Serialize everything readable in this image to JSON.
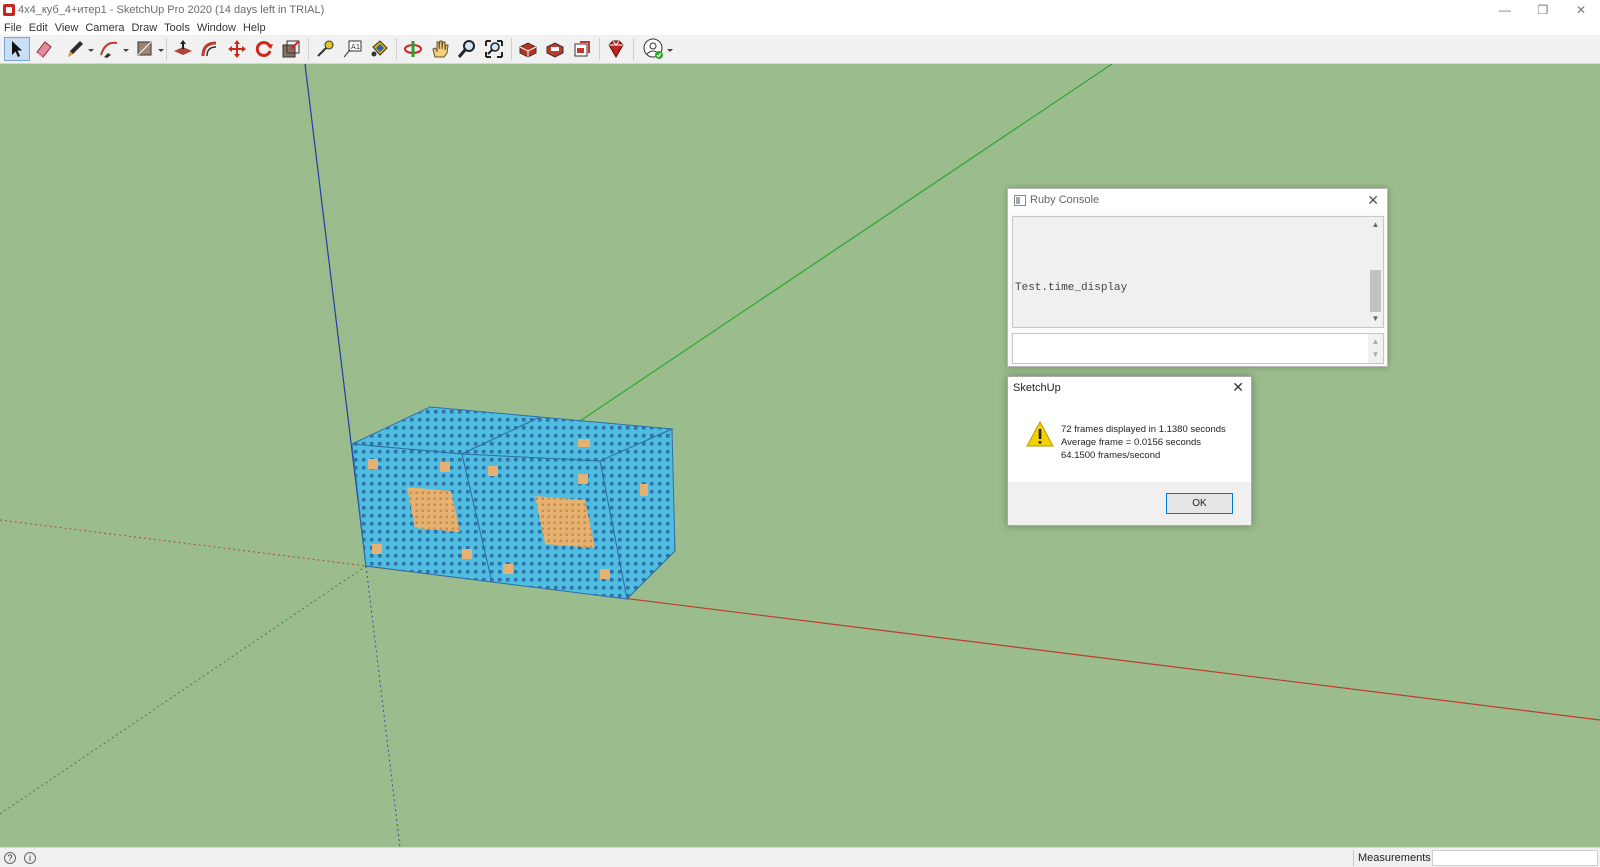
{
  "window": {
    "title": "4x4_куб_4+итер1 - SketchUp Pro 2020 (14 days left in TRIAL)",
    "controls": [
      "minimize",
      "restore",
      "close"
    ]
  },
  "menu": [
    "File",
    "Edit",
    "View",
    "Camera",
    "Draw",
    "Tools",
    "Window",
    "Help"
  ],
  "toolbar": {
    "tools": [
      {
        "name": "select-tool",
        "icon": "arrow-pointer-icon",
        "active": true
      },
      {
        "name": "eraser-tool",
        "icon": "eraser-icon"
      },
      {
        "name": "line-tool",
        "icon": "pencil-icon",
        "dropdown": true
      },
      {
        "name": "arc-tool",
        "icon": "arc-icon",
        "dropdown": true
      },
      {
        "name": "shapes-tool",
        "icon": "rectangle-icon",
        "dropdown": true
      },
      {
        "name": "push-pull-tool",
        "icon": "push-pull-icon"
      },
      {
        "name": "offset-tool",
        "icon": "offset-icon"
      },
      {
        "name": "move-tool",
        "icon": "move-icon"
      },
      {
        "name": "rotate-tool",
        "icon": "rotate-icon"
      },
      {
        "name": "scale-tool",
        "icon": "scale-icon"
      },
      {
        "name": "tape-measure-tool",
        "icon": "tape-measure-icon"
      },
      {
        "name": "text-tool",
        "icon": "text-icon"
      },
      {
        "name": "paint-bucket-tool",
        "icon": "paint-bucket-icon"
      },
      {
        "name": "orbit-tool",
        "icon": "orbit-icon"
      },
      {
        "name": "pan-tool",
        "icon": "hand-icon"
      },
      {
        "name": "zoom-tool",
        "icon": "magnifier-icon"
      },
      {
        "name": "zoom-extents-tool",
        "icon": "zoom-extents-icon"
      },
      {
        "name": "warehouse-tool",
        "icon": "warehouse-icon"
      },
      {
        "name": "extension-warehouse-tool",
        "icon": "extension-warehouse-icon"
      },
      {
        "name": "layout-tool",
        "icon": "layout-icon"
      },
      {
        "name": "extension-manager-tool",
        "icon": "ruby-icon"
      },
      {
        "name": "account-tool",
        "icon": "account-icon",
        "dropdown": true
      }
    ]
  },
  "ruby_console": {
    "title": "Ruby Console",
    "output_line": "Test.time_display",
    "input_value": ""
  },
  "dialog": {
    "title": "SketchUp",
    "message_lines": [
      "72 frames displayed in 1.1380 seconds",
      "Average frame = 0.0156 seconds",
      "64.1500 frames/second"
    ],
    "ok_label": "OK"
  },
  "statusbar": {
    "measurements_label": "Measurements",
    "measurements_value": ""
  },
  "colors": {
    "viewport_bg": "#9bbd8d",
    "cube_face": "#4dbde0",
    "cube_hole": "#2f6fa8",
    "cube_inner": "#e6b171",
    "axis_red": "#c0392b",
    "axis_green": "#2ea62e",
    "axis_blue": "#1f3fa8"
  }
}
